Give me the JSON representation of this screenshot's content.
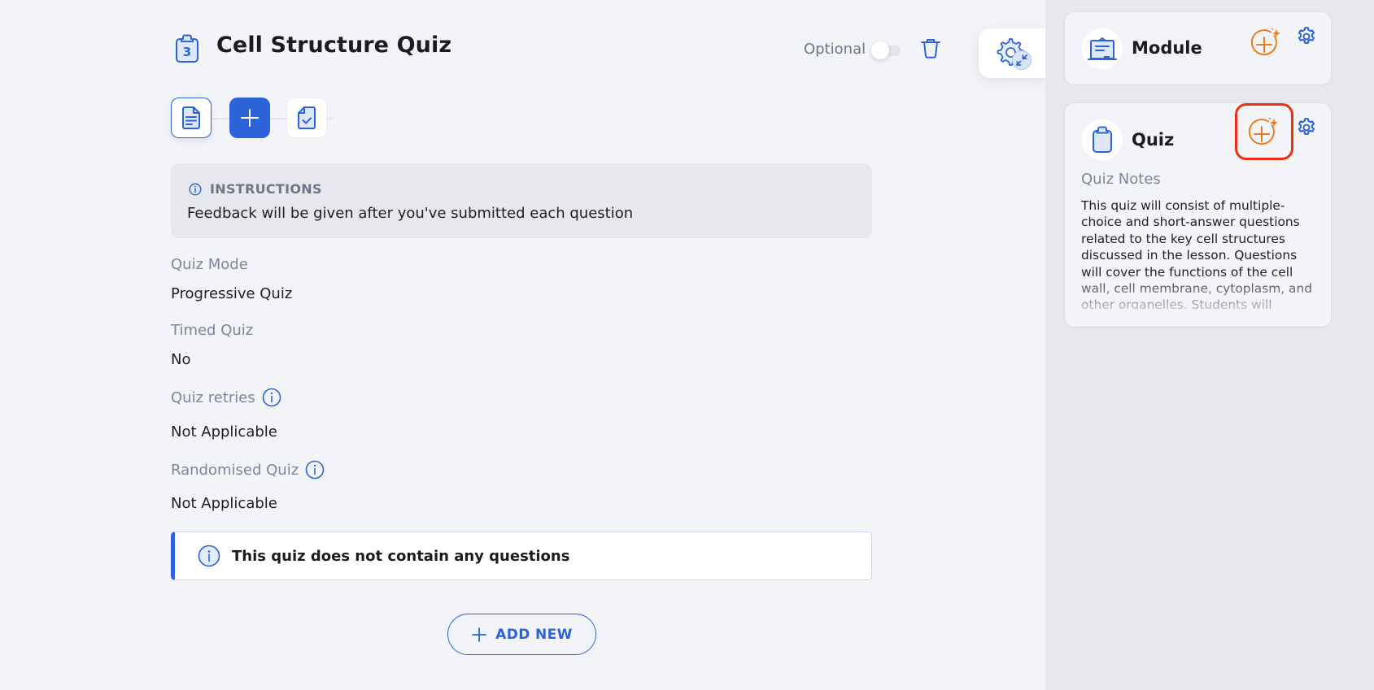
{
  "header": {
    "title": "Cell Structure Quiz",
    "title_icon": "clipboard-number-icon",
    "title_icon_number": "3",
    "optional_label": "Optional",
    "optional_toggle_on": false,
    "delete_icon": "trash-icon",
    "settings_collapse_icon": "gear-collapse-icon"
  },
  "steps": [
    {
      "name": "content",
      "icon": "document-icon",
      "active": false,
      "selected": true
    },
    {
      "name": "add",
      "icon": "plus-icon",
      "active": true,
      "selected": false
    },
    {
      "name": "quiz",
      "icon": "document-check-icon",
      "active": false,
      "selected": false
    }
  ],
  "instructions": {
    "title": "INSTRUCTIONS",
    "text": "Feedback will be given after you've submitted each question"
  },
  "fields": [
    {
      "label": "Quiz Mode",
      "value": "Progressive Quiz",
      "has_info": false
    },
    {
      "label": "Timed Quiz",
      "value": "No",
      "has_info": false
    },
    {
      "label": "Quiz retries",
      "value": "Not Applicable",
      "has_info": true
    },
    {
      "label": "Randomised Quiz",
      "value": "Not Applicable",
      "has_info": true
    }
  ],
  "empty_notice": "This quiz does not contain any questions",
  "add_new_label": "ADD NEW",
  "side": {
    "module_card": {
      "title": "Module",
      "icon": "building-icon"
    },
    "quiz_card": {
      "title": "Quiz",
      "icon": "clipboard-icon",
      "notes_label": "Quiz Notes",
      "notes_text": "This quiz will consist of multiple-choice and short-answer questions related to the key cell structures discussed in the lesson. Questions will cover the functions of the cell wall, cell membrane, cytoplasm, and other organelles. Students will"
    }
  },
  "colors": {
    "accent": "#2c63d8",
    "ai_orange": "#f07a1a",
    "highlight_red": "#ee2f14",
    "main_bg": "#f3f4f8",
    "side_bg": "#e7e8ec",
    "muted_text": "#7a8799"
  }
}
